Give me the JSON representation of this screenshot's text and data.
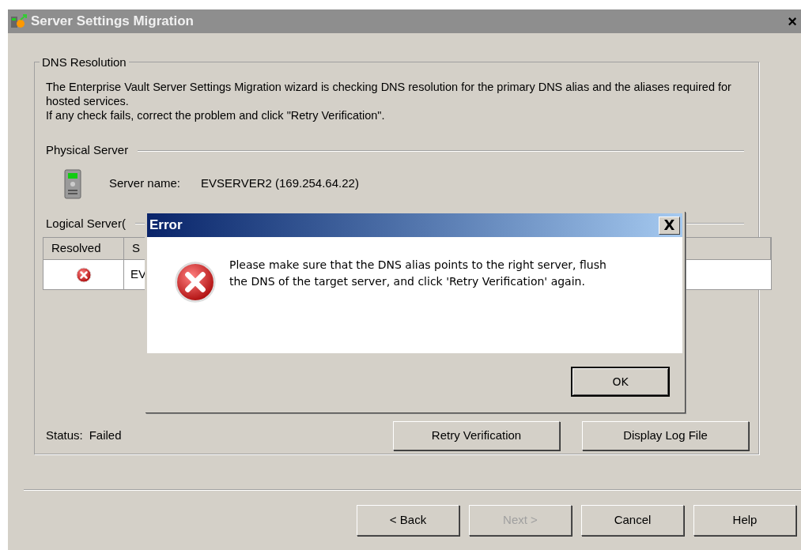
{
  "window": {
    "title": "Server Settings Migration",
    "close": "×"
  },
  "group": {
    "title": "DNS Resolution",
    "description": [
      "The Enterprise Vault Server Settings Migration wizard is checking DNS resolution for the primary DNS alias and the aliases required for hosted services.",
      "If any check fails, correct the problem and click \"Retry Verification\"."
    ]
  },
  "physical_server": {
    "title": "Physical Server",
    "label": "Server name:",
    "value": "EVSERVER2 (169.254.64.22)"
  },
  "logical_servers": {
    "title": "Logical Server(",
    "table": {
      "columns": [
        "Resolved",
        "S"
      ],
      "rows": [
        {
          "resolved": false,
          "cells": [
            "",
            "EV"
          ]
        }
      ]
    }
  },
  "status": {
    "label": "Status:",
    "value": "Failed"
  },
  "actions": [
    "Retry Verification",
    "Display Log File"
  ],
  "buttons": [
    {
      "label": "< Back",
      "disabled": false
    },
    {
      "label": "Next >",
      "disabled": true
    },
    {
      "label": "Cancel",
      "disabled": false
    },
    {
      "label": "Help",
      "disabled": false
    }
  ],
  "dialog": {
    "title": "Error",
    "close": "X",
    "message": "Please make sure that the DNS alias points to the right server, flush the DNS of the target server, and click 'Retry Verification' again.",
    "button": "OK"
  }
}
